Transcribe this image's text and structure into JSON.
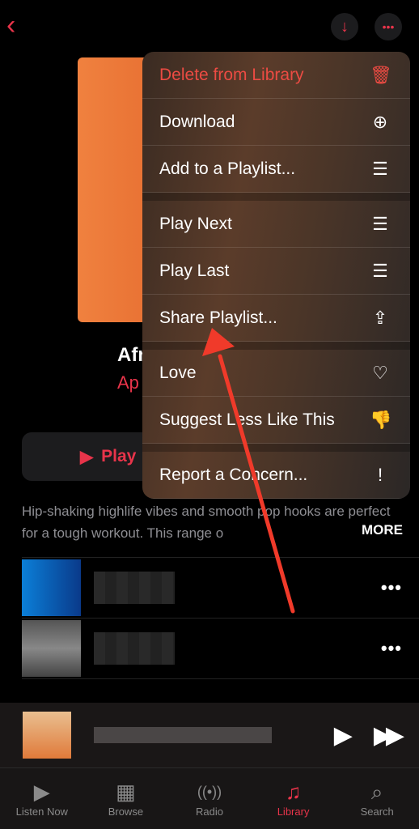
{
  "header": {
    "back_icon": "chevron-left-icon",
    "download_icon": "arrow-down-icon",
    "more_icon": "ellipsis-icon"
  },
  "playlist": {
    "title": "Afr",
    "curator": "Ap",
    "play_label": "Play",
    "description": "Hip-shaking highlife vibes and smooth pop hooks are perfect for a tough workout. This range o",
    "more_label": "MORE"
  },
  "menu": {
    "groups": [
      [
        {
          "label": "Delete from Library",
          "icon": "trash-icon",
          "glyph": "🗑",
          "destructive": true
        },
        {
          "label": "Download",
          "icon": "download-circle-icon",
          "glyph": "⊕"
        },
        {
          "label": "Add to a Playlist...",
          "icon": "add-to-list-icon",
          "glyph": "☰"
        }
      ],
      [
        {
          "label": "Play Next",
          "icon": "play-next-icon",
          "glyph": "☰"
        },
        {
          "label": "Play Last",
          "icon": "play-last-icon",
          "glyph": "☰"
        },
        {
          "label": "Share Playlist...",
          "icon": "share-icon",
          "glyph": "⇪"
        }
      ],
      [
        {
          "label": "Love",
          "icon": "heart-icon",
          "glyph": "♡"
        },
        {
          "label": "Suggest Less Like This",
          "icon": "thumbs-down-icon",
          "glyph": "👎"
        }
      ],
      [
        {
          "label": "Report a Concern...",
          "icon": "report-icon",
          "glyph": "!"
        }
      ]
    ]
  },
  "tabs": [
    {
      "label": "Listen Now",
      "icon": "play-circle-icon",
      "glyph": "▶"
    },
    {
      "label": "Browse",
      "icon": "grid-icon",
      "glyph": "▦"
    },
    {
      "label": "Radio",
      "icon": "radio-icon",
      "glyph": "((•))"
    },
    {
      "label": "Library",
      "icon": "library-icon",
      "glyph": "♫",
      "active": true
    },
    {
      "label": "Search",
      "icon": "search-icon",
      "glyph": "⌕"
    }
  ],
  "colors": {
    "accent": "#e8344a",
    "annotation_arrow": "#f03a2a"
  }
}
